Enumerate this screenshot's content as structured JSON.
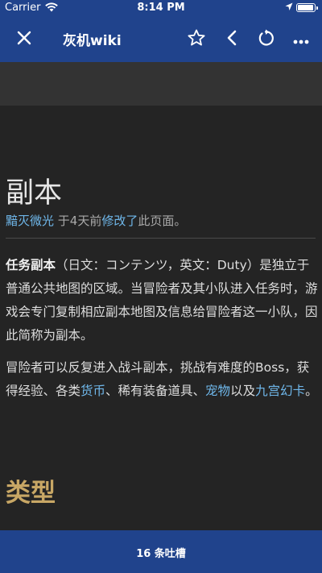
{
  "status_bar": {
    "carrier": "Carrier",
    "time": "8:14 PM",
    "battery_level": 0.95
  },
  "nav": {
    "title": "灰机wiki",
    "icons": [
      "close-icon",
      "star-icon",
      "back-chevron-icon",
      "refresh-icon",
      "more-icon"
    ]
  },
  "article": {
    "title": "副本",
    "meta": {
      "author": "黯灭微光",
      "time_text": " 于4天前",
      "edit_link": "修改了",
      "suffix": "此页面。"
    },
    "para1": {
      "bold": "任务副本",
      "text": "（日文：コンテンツ，英文：Duty）是独立于普通公共地图的区域。当冒险者及其小队进入任务时，游戏会专门复制相应副本地图及信息给冒险者这一小队，因此简称为副本。"
    },
    "para2": {
      "text1": "冒险者可以反复进入战斗副本，挑战有难度的Boss，获得经验、各类",
      "link1": "货币",
      "text2": "、稀有装备道具、",
      "link2": "宠物",
      "text3": "以及",
      "link3": "九宫幻卡",
      "text4": "。"
    },
    "section_title": "类型"
  },
  "bottom_bar": {
    "label": "16 条吐槽"
  },
  "colors": {
    "nav": "#20438c",
    "link": "#6fb7ea",
    "section_heading": "#c8a765",
    "background": "#242424"
  }
}
